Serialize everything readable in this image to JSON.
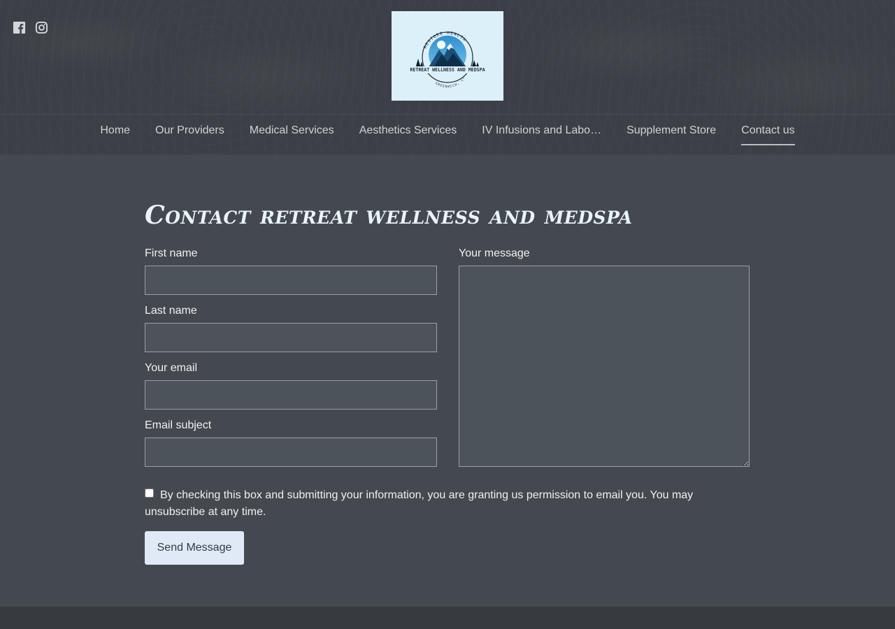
{
  "social": [
    {
      "name": "facebook-icon"
    },
    {
      "name": "instagram-icon"
    }
  ],
  "logo": {
    "top_text": "RESTORE HEALTH",
    "name": "RETREAT WELLNESS AND MEDSPA",
    "bottom_text": "GREENWICH, CT"
  },
  "nav": {
    "items": [
      {
        "label": "Home"
      },
      {
        "label": "Our Providers"
      },
      {
        "label": "Medical Services"
      },
      {
        "label": "Aesthetics Services"
      },
      {
        "label": "IV Infusions and Labo…"
      },
      {
        "label": "Supplement Store"
      },
      {
        "label": "Contact us"
      }
    ],
    "active": "Contact us"
  },
  "page": {
    "title": "Contact retreat wellness and medspa"
  },
  "form": {
    "first_name_label": "First name",
    "first_name_value": "",
    "last_name_label": "Last name",
    "last_name_value": "",
    "email_label": "Your email",
    "email_value": "",
    "subject_label": "Email subject",
    "subject_value": "",
    "message_label": "Your message",
    "message_value": "",
    "consent_text": "By checking this box and submitting your information, you are granting us permission to email you. You may unsubscribe at any time.",
    "consent_checked": false,
    "send_label": "Send Message"
  },
  "colors": {
    "header_bg": "#3c4046",
    "main_bg": "#444950",
    "title": "#e9f3fa",
    "button_bg": "#dfeaf6",
    "logo_bg": "#dcf0fa"
  }
}
